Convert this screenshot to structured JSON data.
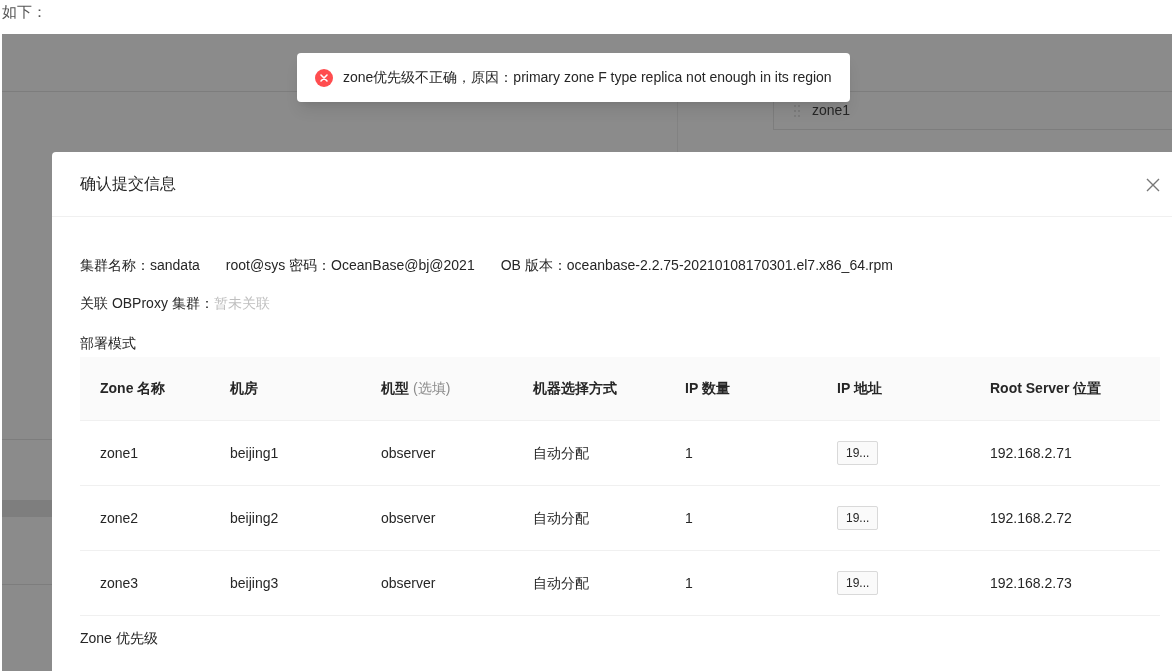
{
  "intro_text": "如下：",
  "background": {
    "list_items": [
      {
        "label": "zone1"
      }
    ]
  },
  "toast": {
    "kind": "error",
    "message": "zone优先级不正确，原因：primary zone F type replica not enough in its region"
  },
  "modal": {
    "title": "确认提交信息",
    "info": [
      {
        "text": "集群名称：sandata"
      },
      {
        "text": "root@sys 密码：OceanBase@bj@2021"
      },
      {
        "text": "OB 版本：oceanbase-2.2.75-20210108170301.el7.x86_64.rpm"
      }
    ],
    "proxy": {
      "label": "关联 OBProxy 集群：",
      "value": "暂未关联"
    },
    "section_title": "部署模式",
    "table": {
      "columns": [
        {
          "label": "Zone 名称"
        },
        {
          "label": "机房"
        },
        {
          "label": "机型",
          "hint": "(选填)"
        },
        {
          "label": "机器选择方式"
        },
        {
          "label": "IP 数量"
        },
        {
          "label": "IP 地址"
        },
        {
          "label": "Root Server 位置"
        }
      ],
      "rows": [
        {
          "cells": [
            "zone1",
            "beijing1",
            "observer",
            "自动分配",
            "1",
            "19...",
            "192.168.2.71"
          ]
        },
        {
          "cells": [
            "zone2",
            "beijing2",
            "observer",
            "自动分配",
            "1",
            "19...",
            "192.168.2.72"
          ]
        },
        {
          "cells": [
            "zone3",
            "beijing3",
            "observer",
            "自动分配",
            "1",
            "19...",
            "192.168.2.73"
          ]
        }
      ]
    },
    "next_section_title": "Zone 优先级"
  }
}
